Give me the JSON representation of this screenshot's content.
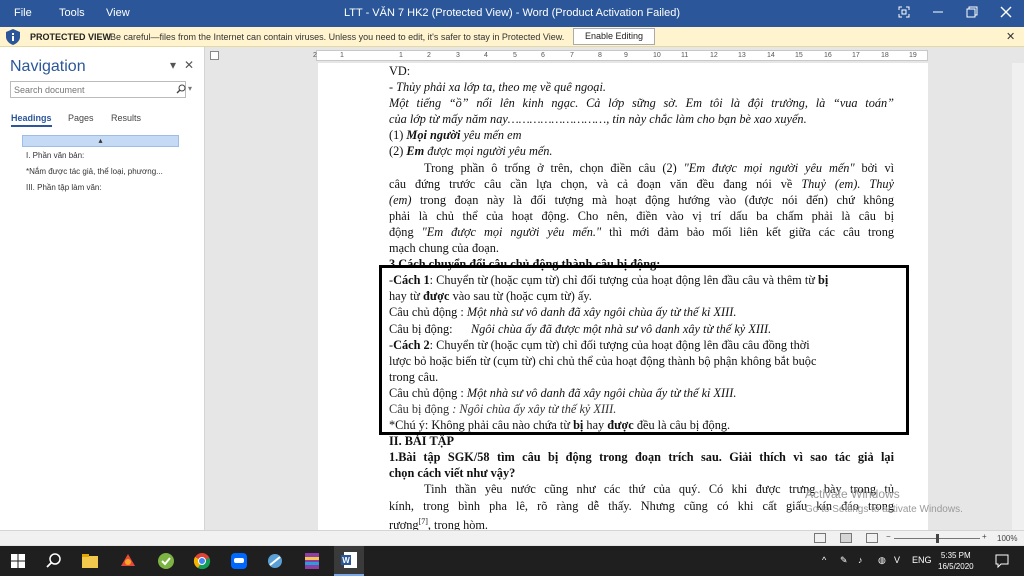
{
  "window": {
    "title": "LTT - VĂN 7 HK2 (Protected View) - Word (Product Activation Failed)"
  },
  "menu": [
    "File",
    "Tools",
    "View"
  ],
  "protected_view": {
    "label": "PROTECTED VIEW",
    "message": "Be careful—files from the Internet can contain viruses. Unless you need to edit, it's safer to stay in Protected View.",
    "button": "Enable Editing"
  },
  "navigation": {
    "title": "Navigation",
    "search_placeholder": "Search document",
    "tabs": [
      "Headings",
      "Pages",
      "Results"
    ],
    "headings": [
      "I. Phần văn bản:",
      "*Nắm được tác giả, thể loại, phương...",
      "III. Phần tập làm văn:"
    ]
  },
  "ruler": [
    "2",
    "1",
    "1",
    "2",
    "3",
    "4",
    "5",
    "6",
    "7",
    "8",
    "9",
    "10",
    "11",
    "12",
    "13",
    "14",
    "15",
    "16",
    "17",
    "18",
    "19"
  ],
  "document": {
    "l01": "VD:",
    "l02": "- Thủy phải xa lớp ta, theo mẹ về quê ngoại.",
    "l03": "Một tiếng “ồ” nổi lên kinh ngạc. Cả lớp sững sờ. Em tôi là đội trưởng, là “vua toán”",
    "l04": "của lớp từ mấy năm nay………………………, tin này chắc làm cho bạn bè xao xuyến.",
    "l05a": "(1) ",
    "l05b": "Mọi người",
    "l05c": " yêu mến em",
    "l06a": "(2) ",
    "l06b": "Em",
    "l06c": " được mọi người yêu mến.",
    "l07a": "Trong phần ô trống ở trên, chọn điền câu  (2) ",
    "l07b": "\"Em được mọi người yêu mến\"",
    "l07c": " bởi vì",
    "l08a": "câu đứng trước câu cần lựa chọn, và cả đoạn văn đều đang nói về ",
    "l08b": "Thuỷ (em). Thuỷ",
    "l09a": "(em)",
    "l09b": " trong đoạn này là đối tượng mà hoạt động hướng vào (được nói đến) chứ không",
    "l10": "phải là chủ thể của hoạt động. Cho nên, điền vào vị trí dấu ba chấm phải là câu bị",
    "l11a": "động ",
    "l11b": "\"Em được mọi người yêu mến.\"",
    "l11c": " thì mới đảm bảo mối liên kết giữa các câu trong",
    "l12": "mạch chung của đoạn.",
    "l13": "3.Cách chuyển đổi câu chủ động thành câu bị động:",
    "l14a": "-",
    "l14b": "Cách 1",
    "l14c": ": Chuyển từ (hoặc cụm từ) chỉ đối tượng của hoạt động lên đầu câu và thêm từ ",
    "l14d": "bị",
    "l15a": "hay từ ",
    "l15b": "được",
    "l15c": " vào sau từ (hoặc cụm từ) ấy.",
    "l16a": "Câu chủ động : ",
    "l16b": "Một nhà sư vô danh đã xây ngôi chùa ấy từ thế kỉ XIII.",
    "l17a": "Câu bị động:      ",
    "l17b": "Ngôi chùa ấy đã được một nhà sư vô danh xây từ thế kỷ XIII.",
    "l18a": "-",
    "l18b": "Cách 2",
    "l18c": ": Chuyển từ (hoặc cụm từ) chỉ đối tượng của hoạt động lên đầu câu đồng thời",
    "l19": "lược bỏ hoặc biến từ (cụm từ) chỉ chủ thể của hoạt động thành bộ phận không bắt buộc",
    "l20": "trong câu.",
    "l21a": "Câu chủ động : ",
    "l21b": "Một nhà sư vô danh đã xây ngôi chùa ấy từ thế kỉ XIII.",
    "l22a": "Câu bị động ",
    "l22b": ": Ngôi chùa ấy xây từ thế kỷ XIII.",
    "l23a": "*Chú ý: Không phải câu nào chứa từ ",
    "l23b": "bị",
    "l23c": " hay ",
    "l23d": "được",
    "l23e": " đều là câu bị động.",
    "l24": "II. BÀI TẬP",
    "l25": "1.Bài tập SGK/58 tìm câu bị động trong đoạn trích sau. Giải thích vì sao tác giả lại",
    "l26": "chọn cách viết như vậy?",
    "l27": "Tinh thần yêu nước cũng như các thứ của quý. Có khi được trưng bày trong tủ",
    "l28": "kính, trong bình pha lê, rõ ràng dễ thấy. Nhưng cũng có khi cất giấu kín đáo trong",
    "l29a": "rương",
    "l29b": "[7]",
    "l29c": ", trong hòm."
  },
  "watermark": {
    "line1": "Activate Windows",
    "line2": "Go to Settings to activate Windows."
  },
  "status": {
    "zoom": "100%"
  },
  "taskbar": {
    "lang": "ENG",
    "time": "5:35 PM",
    "date": "16/5/2020"
  }
}
